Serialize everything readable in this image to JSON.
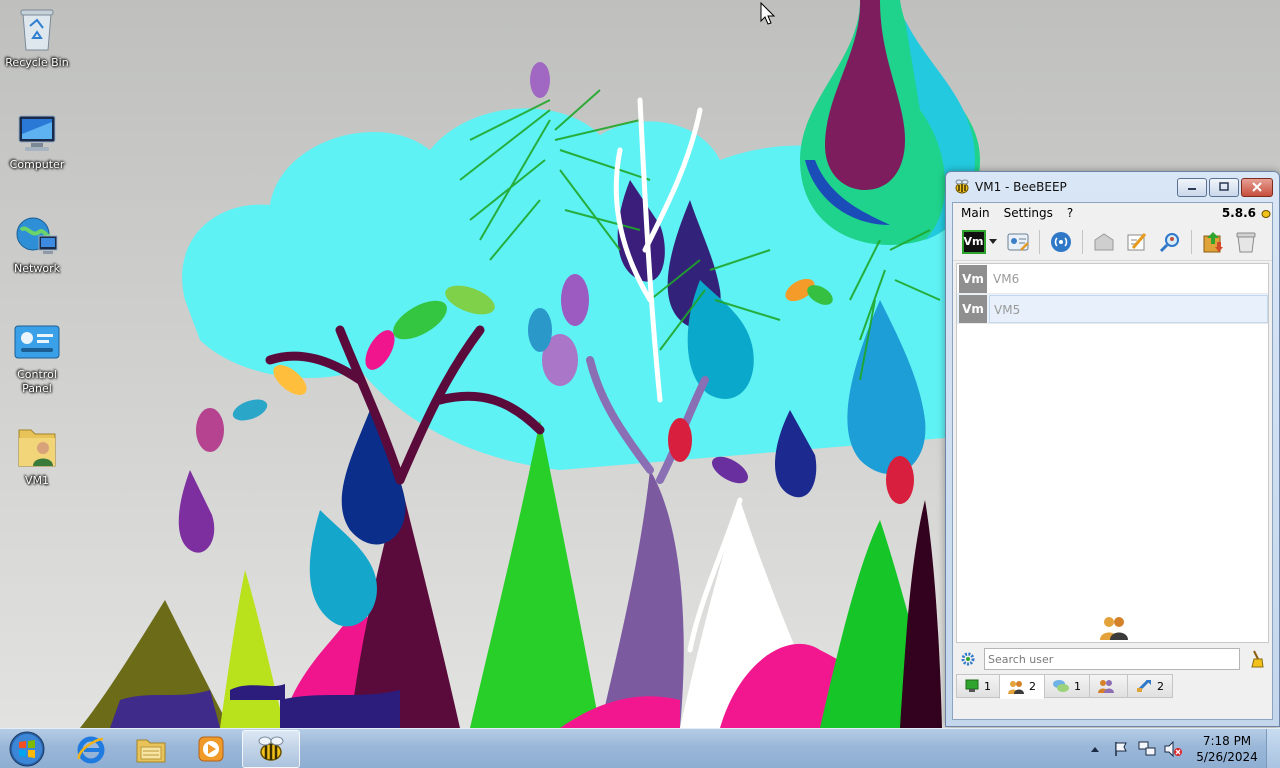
{
  "desktop": {
    "icons": [
      {
        "label": "Recycle Bin",
        "icon": "recycle-bin-icon"
      },
      {
        "label": "Computer",
        "icon": "computer-icon"
      },
      {
        "label": "Network",
        "icon": "network-icon"
      },
      {
        "label": "Control Panel",
        "icon": "control-panel-icon"
      },
      {
        "label": "VM1",
        "icon": "user-folder-icon"
      }
    ]
  },
  "window": {
    "title": "VM1 - BeeBEEP",
    "menu": [
      "Main",
      "Settings",
      "?"
    ],
    "version": "5.8.6",
    "avatar_text": "Vm",
    "users": [
      {
        "badge": "Vm",
        "name": "VM6"
      },
      {
        "badge": "Vm",
        "name": "VM5"
      }
    ],
    "search_placeholder": "Search user",
    "tabs": [
      {
        "icon": "chat-screen-icon",
        "count": "1"
      },
      {
        "icon": "users-icon",
        "count": "2"
      },
      {
        "icon": "chats-icon",
        "count": "1"
      },
      {
        "icon": "groups-icon",
        "count": ""
      },
      {
        "icon": "file-sharing-icon",
        "count": "2"
      }
    ]
  },
  "taskbar": {
    "apps": [
      "internet-explorer-icon",
      "explorer-icon",
      "media-player-icon",
      "beebeep-icon"
    ],
    "tray_icons": [
      "show-hidden-icons-arrow",
      "action-center-flag-icon",
      "network-icon",
      "volume-muted-icon"
    ],
    "time": "7:18 PM",
    "date": "5/26/2024"
  },
  "colors": {
    "taskbar": "#9ab7d8",
    "window_frame": "#c4d6ec",
    "close_button": "#c74e3c"
  }
}
